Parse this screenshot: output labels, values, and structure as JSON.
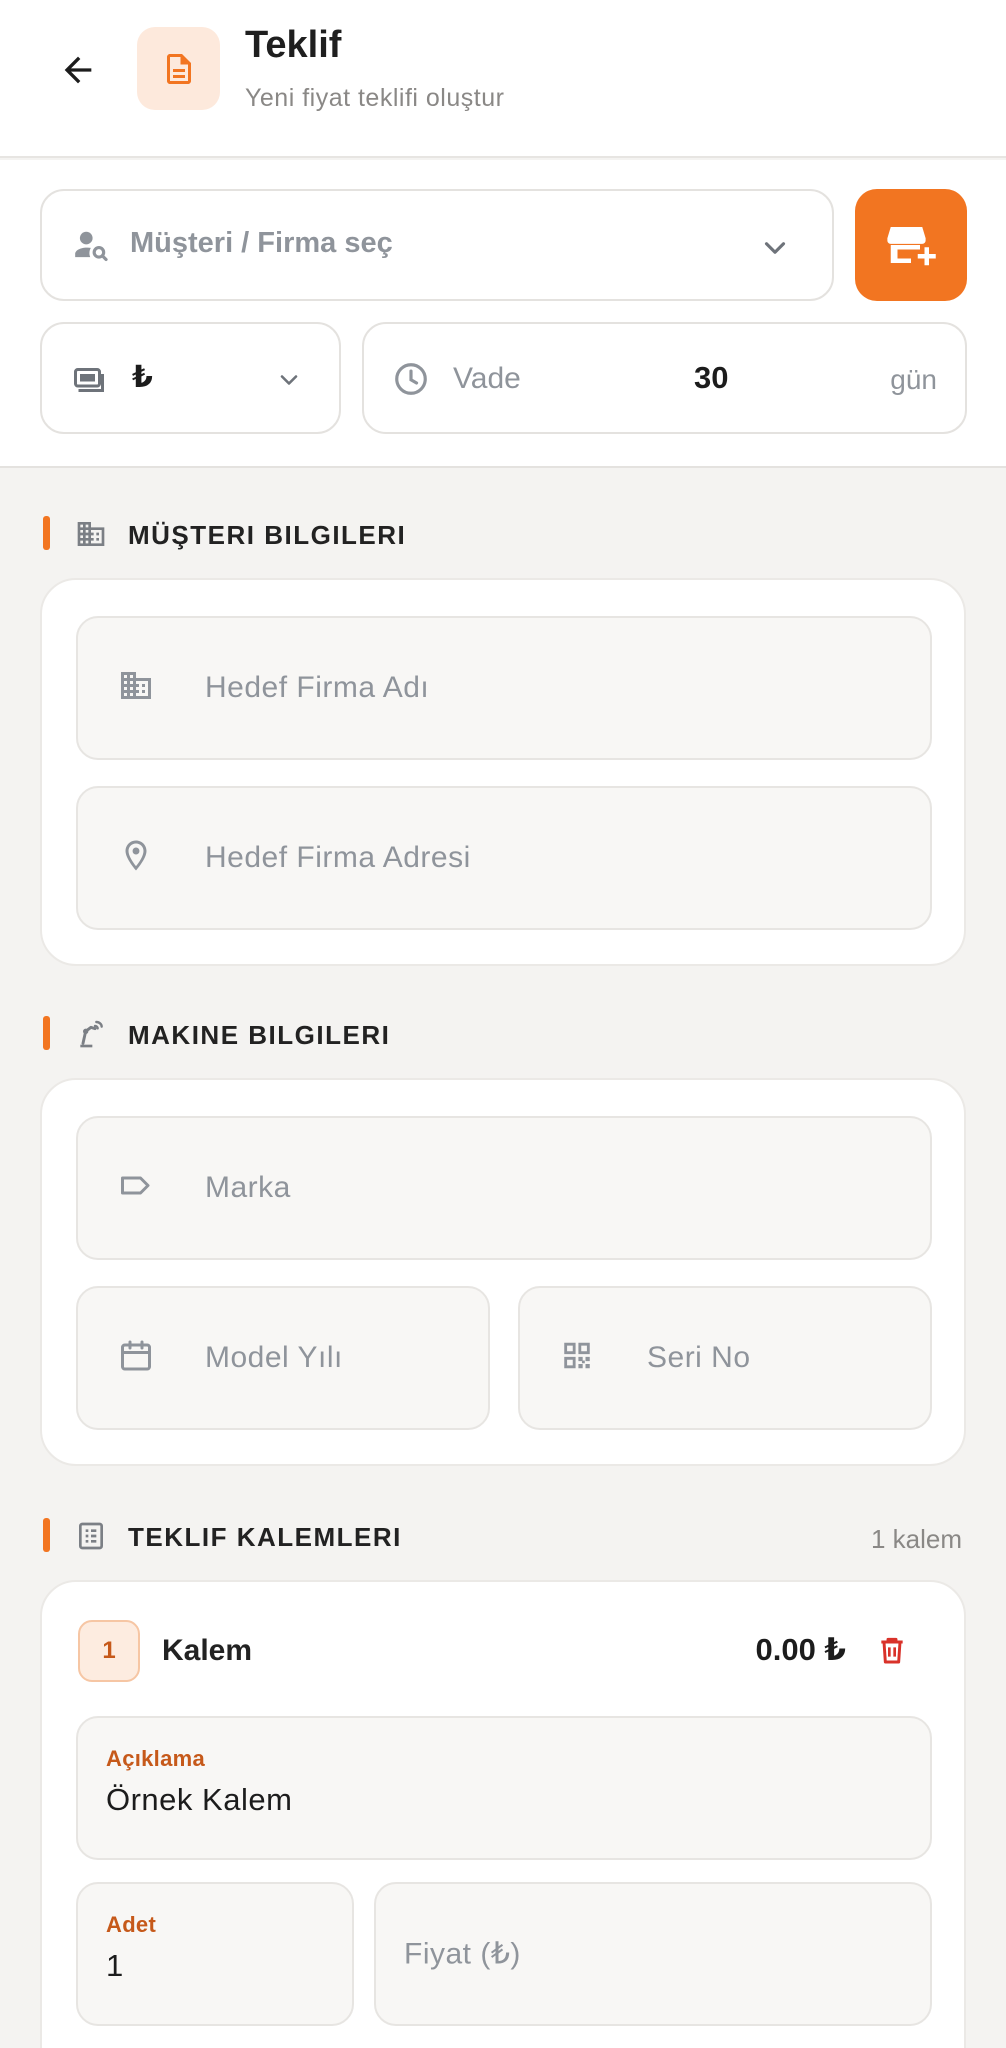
{
  "header": {
    "title": "Teklif",
    "subtitle": "Yeni fiyat teklifi oluştur"
  },
  "toolbar": {
    "customer_placeholder": "Müşteri / Firma seç",
    "currency_value": "₺",
    "vade_label": "Vade",
    "vade_value": "30",
    "vade_unit": "gün"
  },
  "sections": {
    "customer": {
      "title": "MÜŞTERI BILGILERI",
      "company_name_placeholder": "Hedef Firma Adı",
      "company_address_placeholder": "Hedef Firma Adresi"
    },
    "machine": {
      "title": "MAKINE BILGILERI",
      "brand_placeholder": "Marka",
      "model_year_placeholder": "Model Yılı",
      "serial_placeholder": "Seri No"
    },
    "items": {
      "title": "TEKLIF KALEMLERI",
      "count_label": "1 kalem",
      "list": [
        {
          "number": "1",
          "title": "Kalem",
          "total": "0.00 ₺",
          "description_label": "Açıklama",
          "description_value": "Örnek Kalem",
          "qty_label": "Adet",
          "qty_value": "1",
          "price_placeholder": "Fiyat (₺)"
        }
      ]
    }
  },
  "colors": {
    "accent": "#f27521",
    "accent_light": "#fde9dc",
    "label_orange": "#c6591a",
    "delete_red": "#d9322a"
  },
  "icons": {
    "back": "arrow-left-icon",
    "doc": "document-icon",
    "customer": "person-search-icon",
    "add_store": "add-store-icon",
    "currency": "money-icon",
    "clock": "clock-icon",
    "building": "building-icon",
    "location": "location-pin-icon",
    "machine": "robotic-arm-icon",
    "tag": "tag-icon",
    "calendar": "calendar-icon",
    "qr": "qr-code-icon",
    "list": "list-icon",
    "delete": "trash-icon"
  }
}
